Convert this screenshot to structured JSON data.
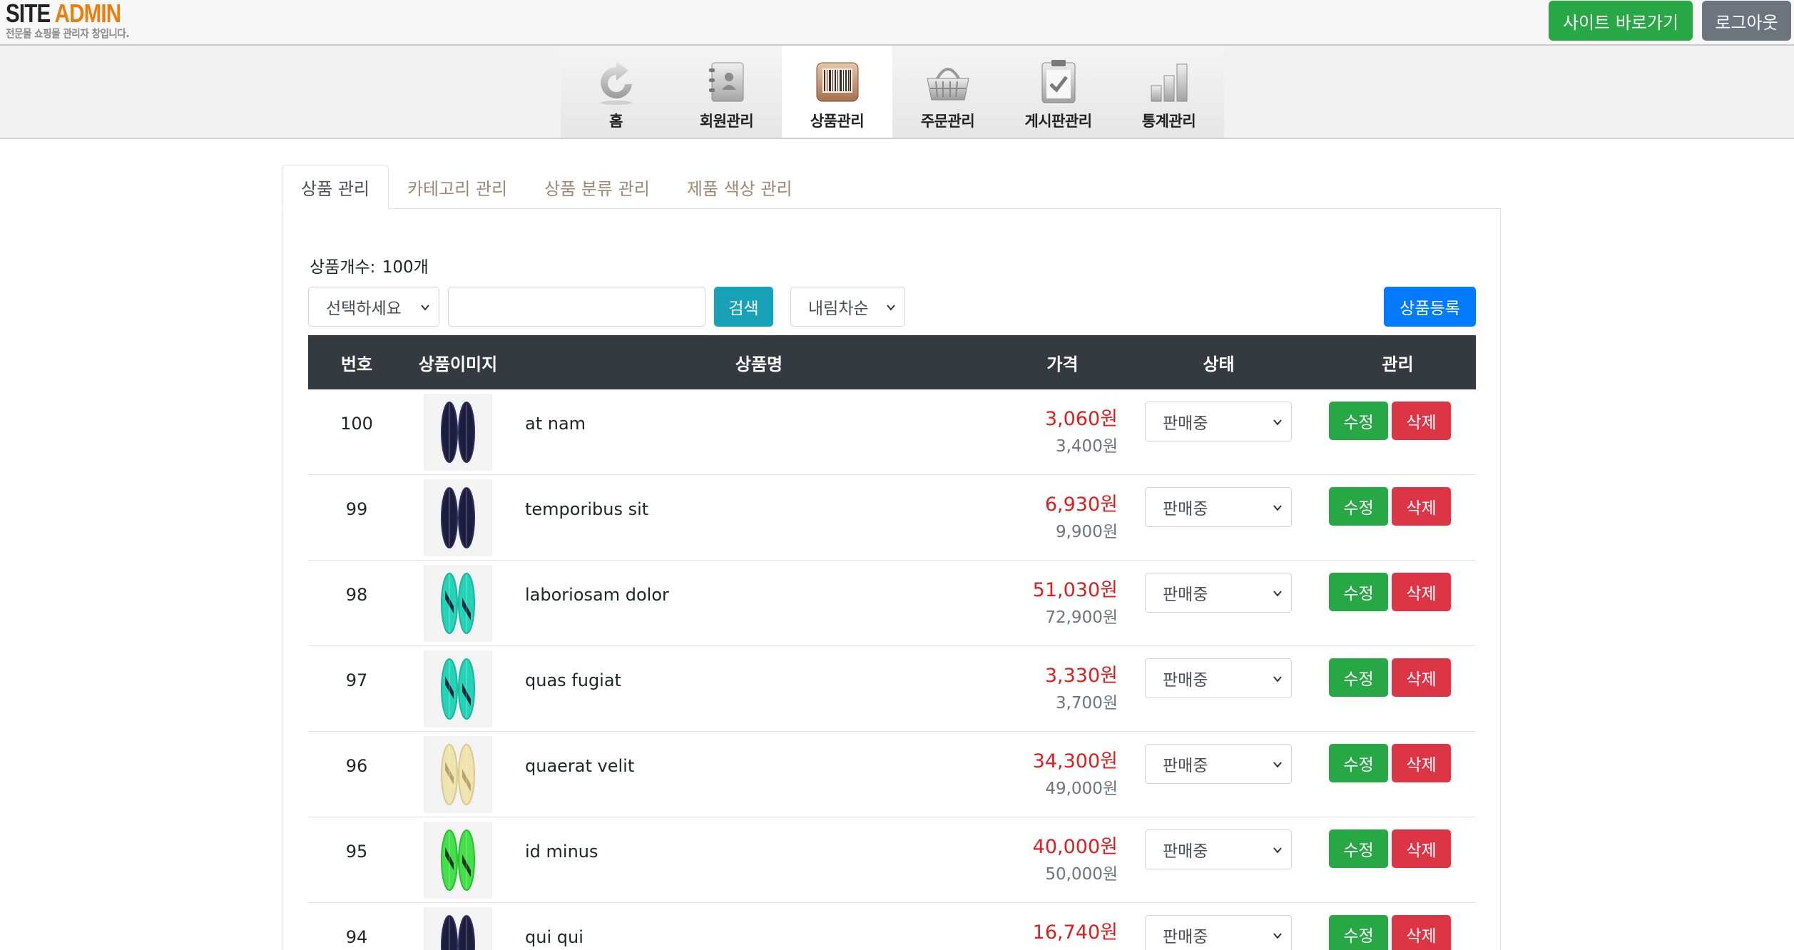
{
  "header": {
    "logo_primary": "SITE",
    "logo_accent": "ADMIN",
    "logo_tagline": "전문몰 쇼핑몰 관리자 창입니다.",
    "site_button": "사이트 바로가기",
    "logout_button": "로그아웃"
  },
  "nav": {
    "items": [
      {
        "label": "홈",
        "icon": "refresh-arrow-icon",
        "active": false
      },
      {
        "label": "회원관리",
        "icon": "address-book-icon",
        "active": false
      },
      {
        "label": "상품관리",
        "icon": "barcode-icon",
        "active": true
      },
      {
        "label": "주문관리",
        "icon": "shopping-basket-icon",
        "active": false
      },
      {
        "label": "게시판관리",
        "icon": "clipboard-check-icon",
        "active": false
      },
      {
        "label": "통계관리",
        "icon": "bar-chart-icon",
        "active": false
      }
    ]
  },
  "tabs": [
    {
      "label": "상품 관리",
      "active": true
    },
    {
      "label": "카테고리 관리",
      "active": false
    },
    {
      "label": "상품 분류 관리",
      "active": false
    },
    {
      "label": "제품 색상 관리",
      "active": false
    }
  ],
  "controls": {
    "count_label": "상품개수:",
    "count_value": "100개",
    "filter_select": "선택하세요",
    "search_value": "",
    "search_button": "검색",
    "sort_select": "내림차순",
    "register_button": "상품등록"
  },
  "table": {
    "columns": [
      "번호",
      "상품이미지",
      "상품명",
      "가격",
      "상태",
      "관리"
    ],
    "rows": [
      {
        "num": "100",
        "name": "at nam",
        "sale_price": "3,060원",
        "orig_price": "3,400원",
        "status": "판매중",
        "image": "dark-navy-surfboards"
      },
      {
        "num": "99",
        "name": "temporibus sit",
        "sale_price": "6,930원",
        "orig_price": "9,900원",
        "status": "판매중",
        "image": "dark-navy-surfboards"
      },
      {
        "num": "98",
        "name": "laboriosam dolor",
        "sale_price": "51,030원",
        "orig_price": "72,900원",
        "status": "판매중",
        "image": "teal-pattern-surfboards"
      },
      {
        "num": "97",
        "name": "quas fugiat",
        "sale_price": "3,330원",
        "orig_price": "3,700원",
        "status": "판매중",
        "image": "teal-pattern-surfboards"
      },
      {
        "num": "96",
        "name": "quaerat velit",
        "sale_price": "34,300원",
        "orig_price": "49,000원",
        "status": "판매중",
        "image": "cream-surfboards"
      },
      {
        "num": "95",
        "name": "id minus",
        "sale_price": "40,000원",
        "orig_price": "50,000원",
        "status": "판매중",
        "image": "green-pattern-surfboards"
      },
      {
        "num": "94",
        "name": "qui qui",
        "sale_price": "16,740원",
        "orig_price": "",
        "status": "판매중",
        "image": "dark-navy-surfboards"
      }
    ],
    "edit_label": "수정",
    "delete_label": "삭제"
  },
  "colors": {
    "success": "#28a745",
    "secondary": "#6c757d",
    "info": "#17a2b8",
    "primary": "#007bff",
    "danger": "#dc3545",
    "price_red": "#dc1e1e",
    "table_head": "#343a40",
    "logo_accent": "#ef7d0b"
  }
}
